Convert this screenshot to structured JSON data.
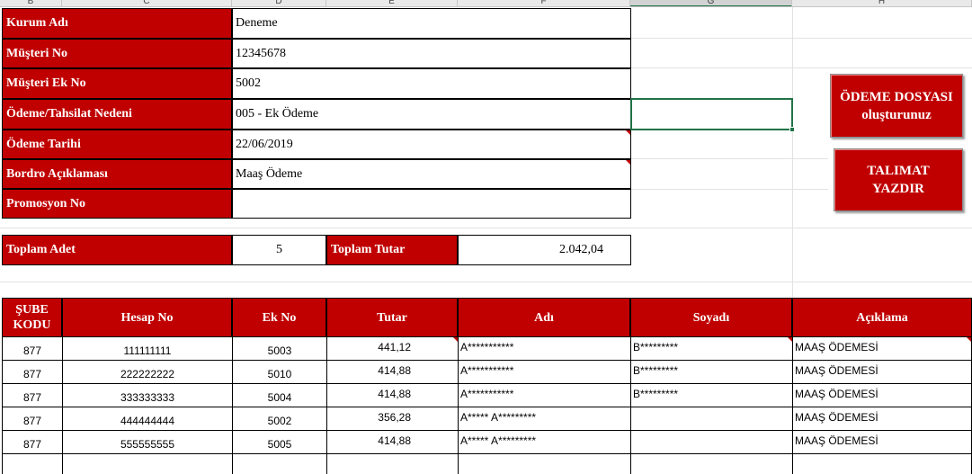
{
  "columns": [
    "B",
    "C",
    "D",
    "E",
    "F",
    "G",
    "H"
  ],
  "form": {
    "kurum_adi_label": "Kurum Adı",
    "kurum_adi_value": "Deneme",
    "musteri_no_label": "Müşteri No",
    "musteri_no_value": "12345678",
    "musteri_ek_no_label": "Müşteri Ek No",
    "musteri_ek_no_value": "5002",
    "odeme_nedeni_label": "Ödeme/Tahsilat Nedeni",
    "odeme_nedeni_value": "005 - Ek Ödeme",
    "odeme_tarihi_label": "Ödeme Tarihi",
    "odeme_tarihi_value": "22/06/2019",
    "bordro_aciklamasi_label": "Bordro Açıklaması",
    "bordro_aciklamasi_value": "Maaş Ödeme",
    "promosyon_no_label": "Promosyon No",
    "promosyon_no_value": ""
  },
  "totals": {
    "adet_label": "Toplam Adet",
    "adet_value": "5",
    "tutar_label": "Toplam Tutar",
    "tutar_value": "2.042,04"
  },
  "buttons": {
    "odeme_dosyasi_line1": "ÖDEME DOSYASI",
    "odeme_dosyasi_line2": "oluşturunuz",
    "talimat_line1": "TALIMAT",
    "talimat_line2": "YAZDIR"
  },
  "table": {
    "headers": {
      "sube_line1": "ŞUBE",
      "sube_line2": "KODU",
      "hesap_no": "Hesap No",
      "ek_no": "Ek No",
      "tutar": "Tutar",
      "adi": "Adı",
      "soyadi": "Soyadı",
      "aciklama": "Açıklama"
    },
    "rows": [
      {
        "sube": "877",
        "hesap": "111111111",
        "ek": "5003",
        "tutar": "441,12",
        "adi": "A***********",
        "soyadi": "B*********",
        "aciklama": "MAAŞ ÖDEMESİ"
      },
      {
        "sube": "877",
        "hesap": "222222222",
        "ek": "5010",
        "tutar": "414,88",
        "adi": "A***********",
        "soyadi": "B*********",
        "aciklama": "MAAŞ ÖDEMESİ"
      },
      {
        "sube": "877",
        "hesap": "333333333",
        "ek": "5004",
        "tutar": "414,88",
        "adi": "A***********",
        "soyadi": "B*********",
        "aciklama": "MAAŞ ÖDEMESİ"
      },
      {
        "sube": "877",
        "hesap": "444444444",
        "ek": "5002",
        "tutar": "356,28",
        "adi": "A***** A*********",
        "soyadi": "",
        "aciklama": "MAAŞ ÖDEMESİ"
      },
      {
        "sube": "877",
        "hesap": "555555555",
        "ek": "5005",
        "tutar": "414,88",
        "adi": "A***** A*********",
        "soyadi": "",
        "aciklama": "MAAŞ ÖDEMESİ"
      }
    ]
  },
  "colors": {
    "accent_red": "#c00000",
    "selection_green": "#217346"
  }
}
